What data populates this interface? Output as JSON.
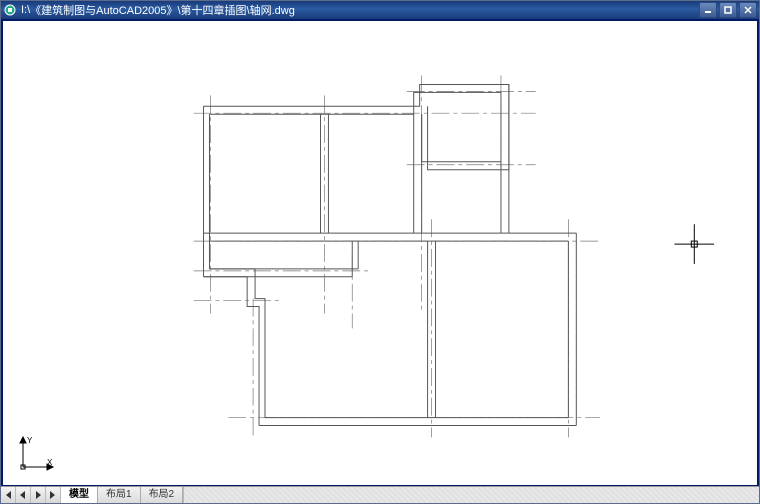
{
  "window": {
    "drive_prefix": "I:\\",
    "title": "《建筑制图与AutoCAD2005》\\第十四章插图\\轴网.dwg"
  },
  "ucs": {
    "x_label": "X",
    "y_label": "Y"
  },
  "tabs": {
    "model": "模型",
    "layout1": "布局1",
    "layout2": "布局2"
  },
  "colors": {
    "titlebar": "#1a3b7a",
    "border": "#001a66",
    "wall_stroke": "#555555",
    "grid_stroke": "#777777"
  }
}
